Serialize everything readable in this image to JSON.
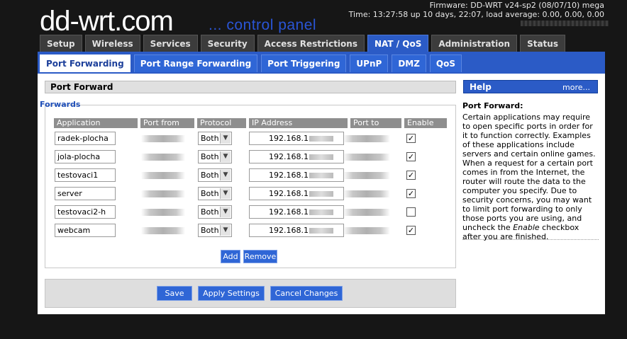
{
  "header": {
    "logo_main": "dd-wrt",
    "logo_suffix": ".com",
    "tagline": "... control panel",
    "firmware": "Firmware: DD-WRT v24-sp2 (08/07/10) mega",
    "uptime": "Time: 13:27:58 up 10 days, 22:07, load average: 0.00, 0.00, 0.00"
  },
  "main_tabs": [
    "Setup",
    "Wireless",
    "Services",
    "Security",
    "Access Restrictions",
    "NAT / QoS",
    "Administration",
    "Status"
  ],
  "main_tab_active": "NAT / QoS",
  "sub_tabs": [
    "Port Forwarding",
    "Port Range Forwarding",
    "Port Triggering",
    "UPnP",
    "DMZ",
    "QoS"
  ],
  "sub_tab_active": "Port Forwarding",
  "section_title": "Port Forward",
  "legend": "Forwards",
  "columns": {
    "application": "Application",
    "port_from": "Port from",
    "protocol": "Protocol",
    "ip_address": "IP Address",
    "port_to": "Port to",
    "enable": "Enable"
  },
  "rows": [
    {
      "application": "radek-plocha",
      "protocol": "Both",
      "ip_prefix": "192.168.1",
      "enabled": true,
      "check": "✓"
    },
    {
      "application": "jola-plocha",
      "protocol": "Both",
      "ip_prefix": "192.168.1",
      "enabled": true,
      "check": "✓"
    },
    {
      "application": "testovaci1",
      "protocol": "Both",
      "ip_prefix": "192.168.1",
      "enabled": true,
      "check": "✓"
    },
    {
      "application": "server",
      "protocol": "Both",
      "ip_prefix": "192.168.1",
      "enabled": true,
      "check": "✓"
    },
    {
      "application": "testovaci2-h",
      "protocol": "Both",
      "ip_prefix": "192.168.1",
      "enabled": false,
      "check": ""
    },
    {
      "application": "webcam",
      "protocol": "Both",
      "ip_prefix": "192.168.1",
      "enabled": true,
      "check": "✓"
    }
  ],
  "buttons": {
    "add": "Add",
    "remove": "Remove",
    "save": "Save",
    "apply": "Apply Settings",
    "cancel": "Cancel Changes"
  },
  "help": {
    "title": "Help",
    "more": "more...",
    "subtitle": "Port Forward:",
    "text_before": "Certain applications may require to open specific ports in order for it to function correctly. Examples of these applications include servers and certain online games. When a request for a certain port comes in from the Internet, the router will route the data to the computer you specify. Due to security concerns, you may want to limit port forwarding to only those ports you are using, and uncheck the ",
    "text_em": "Enable",
    "text_after": " checkbox after you are finished."
  },
  "colors": {
    "accent_blue": "#2b5bc6",
    "tagline_blue": "#2a55d6",
    "background": "#161616"
  }
}
